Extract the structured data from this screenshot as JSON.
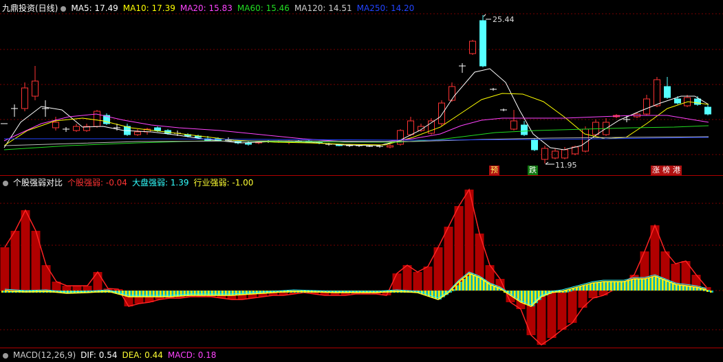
{
  "title": "九鼎投资(日线)",
  "ma": [
    {
      "label": "MA5: 17.49",
      "color": "#ffffff"
    },
    {
      "label": "MA10: 17.39",
      "color": "#ffff00"
    },
    {
      "label": "MA20: 15.83",
      "color": "#ff44ff"
    },
    {
      "label": "MA60: 15.46",
      "color": "#22dd22"
    },
    {
      "label": "MA120: 14.51",
      "color": "#cccccc"
    },
    {
      "label": "MA250: 14.20",
      "color": "#2244ff"
    }
  ],
  "price_panel": {
    "high_label": "25.44",
    "low_label": "11.95",
    "tags": [
      {
        "text": "预",
        "bg": "#b01010",
        "color": "#ffff66"
      },
      {
        "text": "跌",
        "bg": "#117711",
        "color": "#ffffff"
      },
      {
        "text": "涨",
        "bg": "#b01010",
        "color": "#ffffff"
      },
      {
        "text": "榜",
        "bg": "#b01010",
        "color": "#ffffff"
      },
      {
        "text": "港",
        "bg": "#b01010",
        "color": "#ffffff"
      }
    ]
  },
  "strength_panel": {
    "title": "个股强弱对比",
    "items": [
      {
        "label": "个股强弱: -0.04",
        "color": "#ff3333"
      },
      {
        "label": "大盘强弱: 1.39",
        "color": "#33ffff"
      },
      {
        "label": "行业强弱: -1.00",
        "color": "#ffff33"
      }
    ]
  },
  "macd_panel": {
    "title": "MACD(12,26,9)",
    "items": [
      {
        "label": "DIF: 0.54",
        "color": "#ffffff"
      },
      {
        "label": "DEA: 0.44",
        "color": "#ffff33"
      },
      {
        "label": "MACD: 0.18",
        "color": "#ff44ff"
      }
    ]
  },
  "colors": {
    "up": "#ff3333",
    "down": "#55ffff",
    "bar_fill": "#b00000",
    "grid": "#7a0000"
  }
}
